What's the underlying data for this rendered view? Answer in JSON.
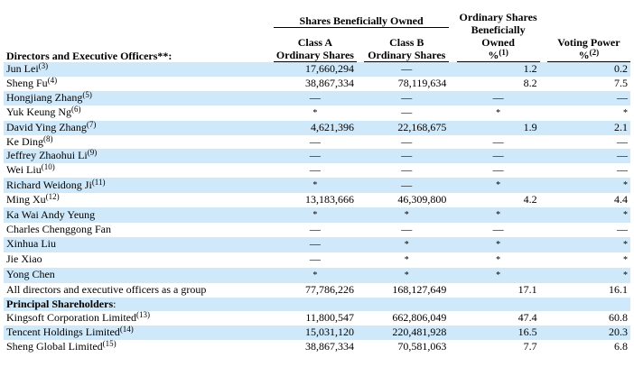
{
  "headers": {
    "group": "Shares Beneficially Owned",
    "class_a": [
      "Class A",
      "Ordinary Shares"
    ],
    "class_b": [
      "Class B",
      "Ordinary Shares"
    ],
    "ownership": [
      "Ordinary Shares",
      "Beneficially",
      "Owned"
    ],
    "ownership_unit": "%",
    "ownership_note": "(1)",
    "voting": "Voting Power",
    "voting_unit": "%",
    "voting_note": "(2)",
    "officers_label": "Directors and Executive Officers**:"
  },
  "rows": [
    {
      "name": "Jun Lei",
      "note": "(3)",
      "a": "17,660,294",
      "b": "—",
      "own": "1.2",
      "vote": "0.2",
      "shade": true
    },
    {
      "name": "Sheng Fu",
      "note": "(4)",
      "a": "38,867,334",
      "b": "78,119,634",
      "own": "8.2",
      "vote": "7.5",
      "shade": false
    },
    {
      "name": "Hongjiang Zhang",
      "note": "(5)",
      "a": "—",
      "b": "—",
      "own": "—",
      "vote": "—",
      "shade": true
    },
    {
      "name": "Yuk Keung Ng",
      "note": "(6)",
      "a": "*",
      "b": "—",
      "own": "*",
      "vote": "*",
      "shade": false
    },
    {
      "name": "David Ying Zhang",
      "note": "(7)",
      "a": "4,621,396",
      "b": "22,168,675",
      "own": "1.9",
      "vote": "2.1",
      "shade": true
    },
    {
      "name": "Ke Ding",
      "note": "(8)",
      "a": "—",
      "b": "—",
      "own": "—",
      "vote": "—",
      "shade": false
    },
    {
      "name": "Jeffrey Zhaohui Li",
      "note": "(9)",
      "a": "—",
      "b": "—",
      "own": "—",
      "vote": "—",
      "shade": true
    },
    {
      "name": "Wei Liu",
      "note": "(10)",
      "a": "—",
      "b": "—",
      "own": "—",
      "vote": "—",
      "shade": false
    },
    {
      "name": "Richard Weidong Ji",
      "note": "(11)",
      "a": "*",
      "b": "—",
      "own": "*",
      "vote": "*",
      "shade": true
    },
    {
      "name": "Ming Xu",
      "note": "(12)",
      "a": "13,183,666",
      "b": "46,309,800",
      "own": "4.2",
      "vote": "4.4",
      "shade": false
    },
    {
      "name": "Ka Wai Andy Yeung",
      "note": "",
      "a": "*",
      "b": "*",
      "own": "*",
      "vote": "*",
      "shade": true
    },
    {
      "name": "Charles Chenggong Fan",
      "note": "",
      "a": "—",
      "b": "—",
      "own": "—",
      "vote": "—",
      "shade": false
    },
    {
      "name": "Xinhua Liu",
      "note": "",
      "a": "—",
      "b": "*",
      "own": "*",
      "vote": "*",
      "shade": true
    },
    {
      "name": "Jie Xiao",
      "note": "",
      "a": "—",
      "b": "*",
      "own": "*",
      "vote": "*",
      "shade": false
    },
    {
      "name": "Yong Chen",
      "note": "",
      "a": "*",
      "b": "*",
      "own": "*",
      "vote": "*",
      "shade": true
    },
    {
      "name": "All directors and executive officers as a group",
      "note": "",
      "a": "77,786,226",
      "b": "168,127,649",
      "own": "17.1",
      "vote": "16.1",
      "shade": false
    }
  ],
  "principal_label": "Principal Shareholders",
  "principal_colon": ":",
  "principal_rows": [
    {
      "name": "Kingsoft Corporation Limited",
      "note": "(13)",
      "a": "11,800,547",
      "b": "662,806,049",
      "own": "47.4",
      "vote": "60.8",
      "shade": false
    },
    {
      "name": "Tencent Holdings Limited",
      "note": "(14)",
      "a": "15,031,120",
      "b": "220,481,928",
      "own": "16.5",
      "vote": "20.3",
      "shade": true
    },
    {
      "name": "Sheng Global Limited",
      "note": "(15)",
      "a": "38,867,334",
      "b": "70,581,063",
      "own": "7.7",
      "vote": "6.8",
      "shade": false
    }
  ]
}
